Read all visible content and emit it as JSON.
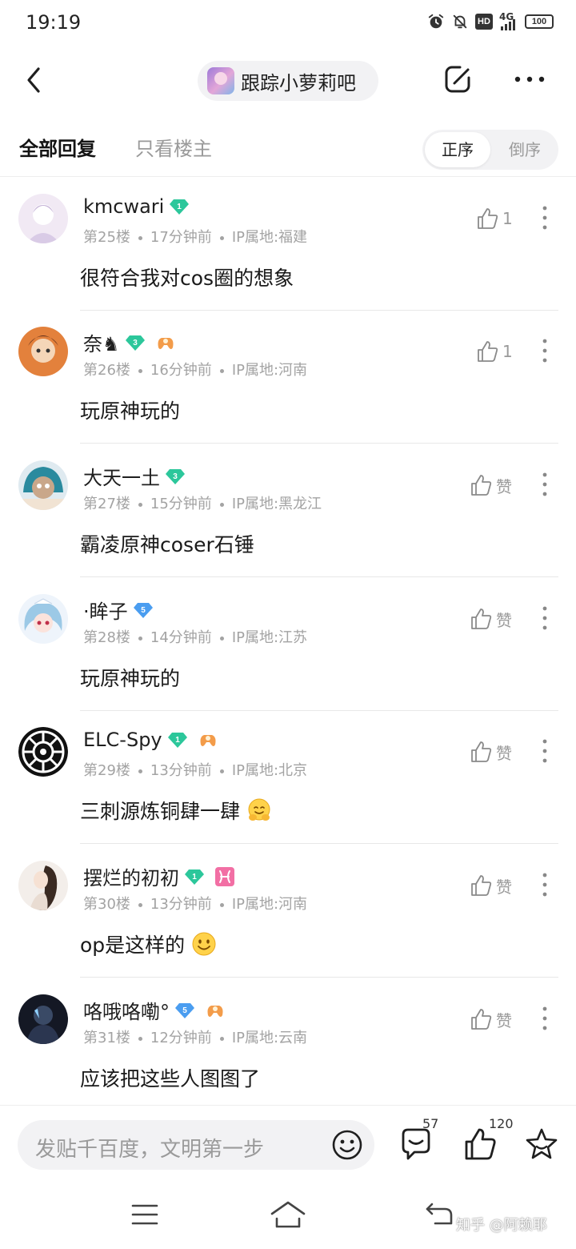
{
  "status_bar": {
    "time": "19:19",
    "network": "4G",
    "hd": "HD",
    "battery": "100",
    "icons": [
      "alarm-icon",
      "mute-icon",
      "hd-icon",
      "signal-icon",
      "battery-icon"
    ]
  },
  "header": {
    "forum_name": "跟踪小萝莉吧",
    "icons": [
      "back-icon",
      "edit-icon",
      "more-icon"
    ]
  },
  "filter": {
    "tab_all": "全部回复",
    "tab_owner": "只看楼主",
    "order_asc": "正序",
    "order_desc": "倒序"
  },
  "replies": [
    {
      "username": "kmcwari",
      "level": "1",
      "level_color": "#2cc79b",
      "floor": "第25楼",
      "time": "17分钟前",
      "ip": "IP属地:福建",
      "content": "很符合我对cos圈的想象",
      "like_label": "1",
      "extra_badge": "",
      "emoji": ""
    },
    {
      "username": "奈♞",
      "level": "3",
      "level_color": "#2cc79b",
      "floor": "第26楼",
      "time": "16分钟前",
      "ip": "IP属地:河南",
      "content": "玩原神玩的",
      "like_label": "1",
      "extra_badge": "gamepad-badge-icon",
      "emoji": ""
    },
    {
      "username": "大天一土",
      "level": "3",
      "level_color": "#2cc79b",
      "floor": "第27楼",
      "time": "15分钟前",
      "ip": "IP属地:黑龙江",
      "content": "霸凌原神coser石锤",
      "like_label": "赞",
      "extra_badge": "",
      "emoji": ""
    },
    {
      "username": "·眸子",
      "level": "5",
      "level_color": "#4a9df0",
      "floor": "第28楼",
      "time": "14分钟前",
      "ip": "IP属地:江苏",
      "content": "玩原神玩的",
      "like_label": "赞",
      "extra_badge": "",
      "emoji": ""
    },
    {
      "username": "ELC-Spy",
      "level": "1",
      "level_color": "#2cc79b",
      "floor": "第29楼",
      "time": "13分钟前",
      "ip": "IP属地:北京",
      "content": "三刺源炼铜肆一肆",
      "like_label": "赞",
      "extra_badge": "gamepad-badge-icon",
      "emoji": "hug-emoji-icon"
    },
    {
      "username": "摆烂的初初",
      "level": "1",
      "level_color": "#2cc79b",
      "floor": "第30楼",
      "time": "13分钟前",
      "ip": "IP属地:河南",
      "content": "op是这样的",
      "like_label": "赞",
      "extra_badge": "pisces-badge-icon",
      "emoji": "smile-emoji-icon"
    },
    {
      "username": "咯哦咯嘞°",
      "level": "5",
      "level_color": "#4a9df0",
      "floor": "第31楼",
      "time": "12分钟前",
      "ip": "IP属地:云南",
      "content": "应该把这些人图图了",
      "like_label": "赞",
      "extra_badge": "gamepad-badge-icon",
      "emoji": ""
    }
  ],
  "bottom_bar": {
    "placeholder": "发贴千百度，文明第一步",
    "comment_count": "57",
    "like_count": "120",
    "icons": [
      "emoji-icon",
      "comment-icon",
      "like-icon",
      "star-icon"
    ]
  },
  "system_nav": {
    "watermark": "知乎 @阿赖耶",
    "icons": [
      "menu-icon",
      "home-icon",
      "back-nav-icon"
    ]
  }
}
